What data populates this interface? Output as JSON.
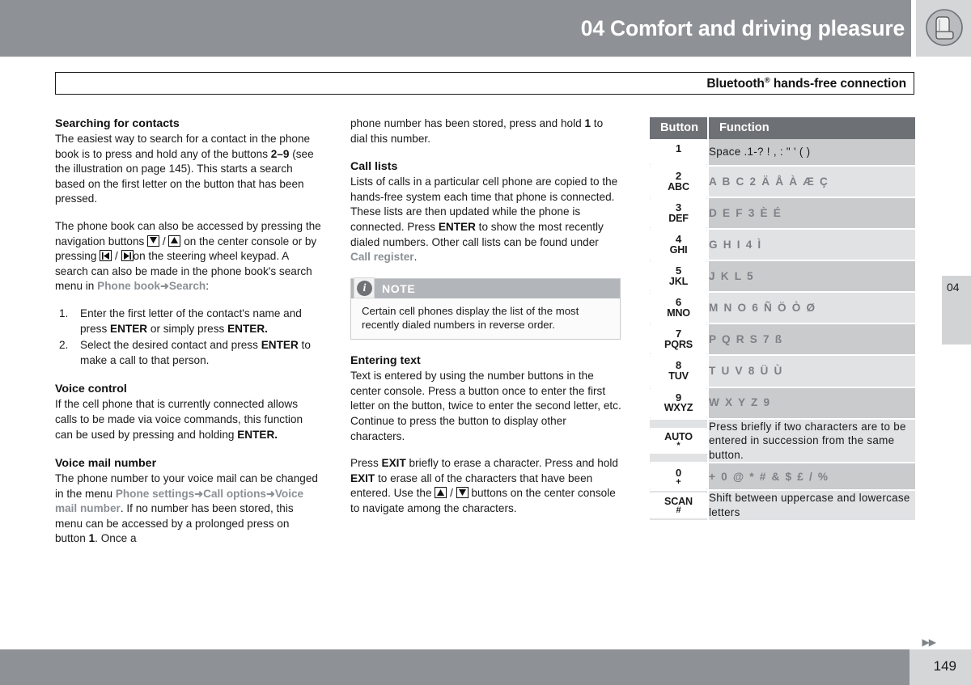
{
  "header": {
    "chapter_title": "04 Comfort and driving pleasure",
    "icon": "car-seat-icon"
  },
  "section": {
    "title_main": "Bluetooth",
    "title_sup": "®",
    "title_rest": " hands-free connection"
  },
  "left_column": {
    "heading_1": "Searching for contacts",
    "para_1_a": "The easiest way to search for a contact in the phone book is to press and hold any of the buttons ",
    "para_1_b": "2–9",
    "para_1_c": " (see the illustration on page 145). This starts a search based on the first letter on the button that has been pressed.",
    "para_2_a": "The phone book can also be accessed by pressing the navigation buttons ",
    "para_2_b": " / ",
    "para_2_c": " on the center console or by pressing ",
    "para_2_d": " / ",
    "para_2_e": "on the steering wheel keypad. A search can also be made in the phone book's search menu in ",
    "menu_phone_book": "Phone book",
    "menu_arrow": "➜",
    "menu_search": "Search",
    "para_2_end": ":",
    "steps": [
      {
        "num": "1.",
        "text_a": "Enter the first letter of the contact's name and press ",
        "bold_1": "ENTER",
        "text_b": " or simply press ",
        "bold_2": "ENTER."
      },
      {
        "num": "2.",
        "text_a": "Select the desired contact and press ",
        "bold_1": "ENTER",
        "text_b": " to make a call to that person.",
        "bold_2": ""
      }
    ],
    "heading_2": "Voice control",
    "para_3_a": "If the cell phone that is currently connected allows calls to be made via voice commands, this function can be used by pressing and holding ",
    "para_3_bold": "ENTER.",
    "heading_3": "Voice mail number",
    "para_4_a": "The phone number to your voice mail can be changed in the menu ",
    "menu_phone_settings": "Phone settings",
    "menu_call_options": "Call options",
    "menu_voice_mail": "Voice mail number",
    "para_4_b": ". If no number has been stored, this menu can be accessed by a prolonged press on button ",
    "para_4_bold": "1",
    "para_4_c": ". Once a"
  },
  "middle_column": {
    "para_1_a": "phone number has been stored, press and hold ",
    "para_1_bold": "1",
    "para_1_b": " to dial this number.",
    "heading_1": "Call lists",
    "para_2_a": "Lists of calls in a particular cell phone are copied to the hands-free system each time that phone is connected. These lists are then updated while the phone is connected. Press ",
    "para_2_bold": "ENTER",
    "para_2_b": " to show the most recently dialed numbers. Other call lists can be found under ",
    "menu_call_register": "Call register",
    "para_2_c": ".",
    "note": {
      "icon": "info-icon",
      "icon_char": "i",
      "title": "NOTE",
      "body": "Certain cell phones display the list of the most recently dialed numbers in reverse order."
    },
    "heading_2": "Entering text",
    "para_3": "Text is entered by using the number buttons in the center console. Press a button once to enter the first letter on the button, twice to enter the second letter, etc. Continue to press the button to display other characters.",
    "para_4_a": "Press ",
    "para_4_bold_1": "EXIT",
    "para_4_b": " briefly to erase a character. Press and hold ",
    "para_4_bold_2": "EXIT",
    "para_4_c": " to erase all of the characters that have been entered. Use the ",
    "para_4_d": " / ",
    "para_4_e": " buttons on the center console to navigate among the characters."
  },
  "table": {
    "headers": [
      "Button",
      "Function"
    ],
    "rows": [
      {
        "key_big": "1",
        "key_small": "",
        "key_tiny": "",
        "function": "Space .1-? ! , : \" ' ( )",
        "style": "mixed"
      },
      {
        "key_big": "2",
        "key_small": "ABC",
        "key_tiny": "",
        "function": "A B C 2 Ä Å À Æ Ç",
        "style": "chars"
      },
      {
        "key_big": "3",
        "key_small": "DEF",
        "key_tiny": "",
        "function": "D E F 3 È É",
        "style": "chars"
      },
      {
        "key_big": "4",
        "key_small": "GHI",
        "key_tiny": "",
        "function": "G H I 4 Ì",
        "style": "chars"
      },
      {
        "key_big": "5",
        "key_small": "JKL",
        "key_tiny": "",
        "function": "J K L 5",
        "style": "chars"
      },
      {
        "key_big": "6",
        "key_small": "MNO",
        "key_tiny": "",
        "function": "M N O 6 Ñ Ö Ò Ø",
        "style": "chars"
      },
      {
        "key_big": "7",
        "key_small": "PQRS",
        "key_tiny": "",
        "function": "P Q R S 7 ß",
        "style": "chars"
      },
      {
        "key_big": "8",
        "key_small": "TUV",
        "key_tiny": "",
        "function": "T U V 8 Ü Ù",
        "style": "chars"
      },
      {
        "key_big": "9",
        "key_small": "WXYZ",
        "key_tiny": "",
        "function": "W X Y Z 9",
        "style": "chars"
      },
      {
        "key_big": "",
        "key_small": "AUTO",
        "key_tiny": "*",
        "function": "Press briefly if two characters are to be entered in succession from the same button.",
        "style": "mixed"
      },
      {
        "key_big": "0",
        "key_small": "",
        "key_tiny": "+",
        "function": "+ 0 @ * # & $ £ / %",
        "style": "chars"
      },
      {
        "key_big": "",
        "key_small": "SCAN",
        "key_tiny": "#",
        "function": "Shift between uppercase and lowercase letters",
        "style": "mixed"
      }
    ]
  },
  "side_tab": {
    "label": "04"
  },
  "footer": {
    "arrows": "▶▶",
    "page_number": "149"
  },
  "colors": {
    "band_gray": "#8e9196",
    "tab_gray": "#d5d6d8",
    "table_header": "#6d7075",
    "row_dark": "#c9cbcd",
    "row_light": "#e1e2e4",
    "menu_text": "#8b9095"
  }
}
